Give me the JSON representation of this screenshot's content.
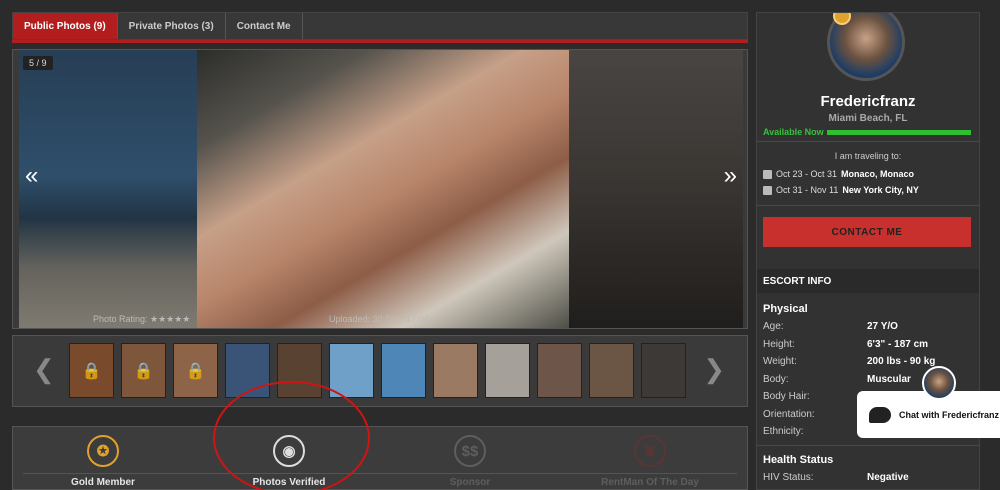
{
  "tabs": [
    {
      "label": "Public Photos (9)",
      "active": true
    },
    {
      "label": "Private Photos (3)",
      "active": false
    },
    {
      "label": "Contact Me",
      "active": false
    }
  ],
  "gallery": {
    "counter": "5 / 9",
    "prev_arrow": "«",
    "next_arrow": "»",
    "rating_label": "Photo Rating: ★★★★★",
    "upload_text": "Uploaded: 30 Sep, 17:04"
  },
  "thumbstrip": {
    "prev_arrow": "❮",
    "next_arrow": "❯",
    "thumbs": [
      {
        "locked": true,
        "color": "#7a4a2c"
      },
      {
        "locked": true,
        "color": "#7d563c"
      },
      {
        "locked": true,
        "color": "#8d6448"
      },
      {
        "locked": false,
        "color": "#3a5478"
      },
      {
        "locked": false,
        "color": "#5a4232"
      },
      {
        "locked": false,
        "color": "#6ea0c8"
      },
      {
        "locked": false,
        "color": "#4f86b8"
      },
      {
        "locked": false,
        "color": "#9a7a62"
      },
      {
        "locked": false,
        "color": "#a6a09a"
      },
      {
        "locked": false,
        "color": "#6d5649"
      },
      {
        "locked": false,
        "color": "#6b5646"
      },
      {
        "locked": false,
        "color": "#3d3936"
      }
    ]
  },
  "badges": [
    {
      "label": "Gold Member",
      "icon": "medal-icon",
      "glyph": "✪",
      "color": "#e0a22c",
      "active": true
    },
    {
      "label": "Photos Verified",
      "icon": "camera-icon",
      "glyph": "◉",
      "color": "#dddddd",
      "active": true
    },
    {
      "label": "Sponsor",
      "icon": "dollar-icon",
      "glyph": "$$",
      "color": "#5e5e5e",
      "active": false
    },
    {
      "label": "RentMan Of The Day",
      "icon": "trophy-icon",
      "glyph": "♛",
      "color": "#5b3535",
      "active": false
    }
  ],
  "profile": {
    "name": "Fredericfranz",
    "location": "Miami Beach, FL",
    "available": "Available Now",
    "travel_title": "I am traveling to:",
    "trips": [
      {
        "dates": "Oct 23 - Oct 31",
        "place": "Monaco, Monaco"
      },
      {
        "dates": "Oct 31 - Nov 11",
        "place": "New York City, NY"
      }
    ],
    "contact_button": "CONTACT ME",
    "escort_info_header": "ESCORT INFO",
    "physical_title": "Physical",
    "physical": [
      {
        "key": "Age:",
        "value": "27 Y/O"
      },
      {
        "key": "Height:",
        "value": "6'3\" - 187 cm"
      },
      {
        "key": "Weight:",
        "value": "200 lbs - 90 kg"
      },
      {
        "key": "Body:",
        "value": "Muscular"
      },
      {
        "key": "Body Hair:",
        "value": ""
      },
      {
        "key": "Orientation:",
        "value": ""
      },
      {
        "key": "Ethnicity:",
        "value": ""
      }
    ],
    "health_title": "Health Status",
    "health": [
      {
        "key": "HIV Status:",
        "value": "Negative"
      }
    ]
  },
  "chat": {
    "label": "Chat with Fredericfranz"
  }
}
